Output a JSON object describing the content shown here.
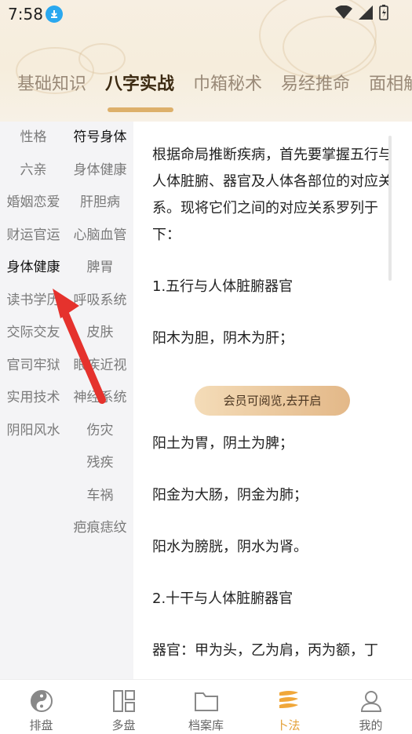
{
  "status_bar": {
    "time": "7:58"
  },
  "tabs": [
    {
      "label": "基础知识"
    },
    {
      "label": "八字实战"
    },
    {
      "label": "巾箱秘术"
    },
    {
      "label": "易经推命"
    },
    {
      "label": "面相解"
    }
  ],
  "sidebar": {
    "left": [
      "性格",
      "六亲",
      "婚姻恋爱",
      "财运官运",
      "身体健康",
      "读书学历",
      "交际交友",
      "官司牢狱",
      "实用技术",
      "阴阳风水"
    ],
    "right": [
      "符号身体",
      "身体健康",
      "肝胆病",
      "心脑血管",
      "脾胃",
      "呼吸系统",
      "皮肤",
      "眼疾近视",
      "神经系统",
      "伤灾",
      "残疾",
      "车祸",
      "疤痕痣纹"
    ]
  },
  "content": {
    "p1": "根据命局推断疾病，首先要掌握五行与人体脏腑、器官及人体各部位的对应关系。现将它们之间的对应关系罗列于下：",
    "p2": "1.五行与人体脏腑器官",
    "p3": "阳木为胆，阴木为肝；",
    "member_button": "会员可阅览,去开启",
    "p4": "阳土为胃，阴土为脾；",
    "p5": "阳金为大肠，阴金为肺；",
    "p6": "阳水为膀胱，阴水为肾。",
    "p7": "2.十干与人体脏腑器官",
    "p8": "器官：甲为头，乙为肩，丙为额，丁"
  },
  "bottom_nav": [
    {
      "label": "排盘",
      "icon": "yin-yang-icon"
    },
    {
      "label": "多盘",
      "icon": "multi-board-icon"
    },
    {
      "label": "档案库",
      "icon": "folder-icon"
    },
    {
      "label": "卜法",
      "icon": "divination-icon"
    },
    {
      "label": "我的",
      "icon": "profile-icon"
    }
  ],
  "colors": {
    "accent": "#e4a23c",
    "tab_underline": "#ddb06b",
    "sidebar_bg": "#f4f4f6"
  }
}
